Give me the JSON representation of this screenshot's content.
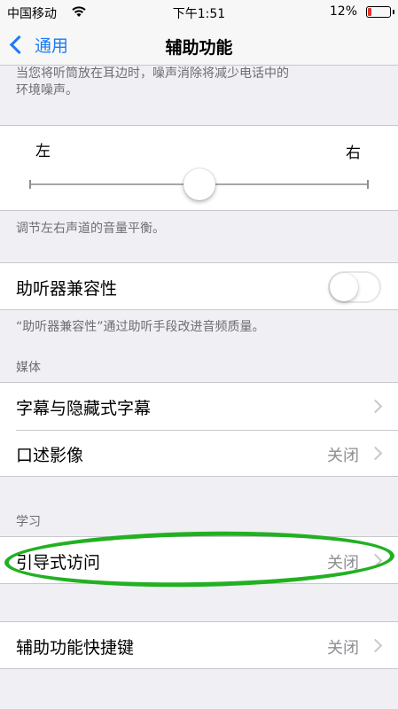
{
  "status_bar": {
    "carrier": "中国移动",
    "time": "下午1:51",
    "battery_percent": "12%"
  },
  "nav": {
    "back_label": "通用",
    "title": "辅助功能"
  },
  "noise_cancel": {
    "footer_line1": "当您将听筒放在耳边时，噪声消除将减少电话中的",
    "footer_line2": "环境噪声。"
  },
  "balance": {
    "left_label": "左",
    "right_label": "右",
    "slider_value": 0.5,
    "footer": "调节左右声道的音量平衡。"
  },
  "hearing_aid": {
    "label": "助听器兼容性",
    "enabled": false,
    "footer": "“助听器兼容性”通过助听手段改进音频质量。"
  },
  "media": {
    "header": "媒体",
    "rows": [
      {
        "label": "字幕与隐藏式字幕",
        "value": ""
      },
      {
        "label": "口述影像",
        "value": "关闭"
      }
    ]
  },
  "learning": {
    "header": "学习",
    "rows": [
      {
        "label": "引导式访问",
        "value": "关闭"
      }
    ]
  },
  "shortcut": {
    "label": "辅助功能快捷键",
    "value": "关闭"
  },
  "colors": {
    "accent": "#1a7cf5",
    "annotation": "#22b022",
    "battery_low": "#e3352b"
  }
}
